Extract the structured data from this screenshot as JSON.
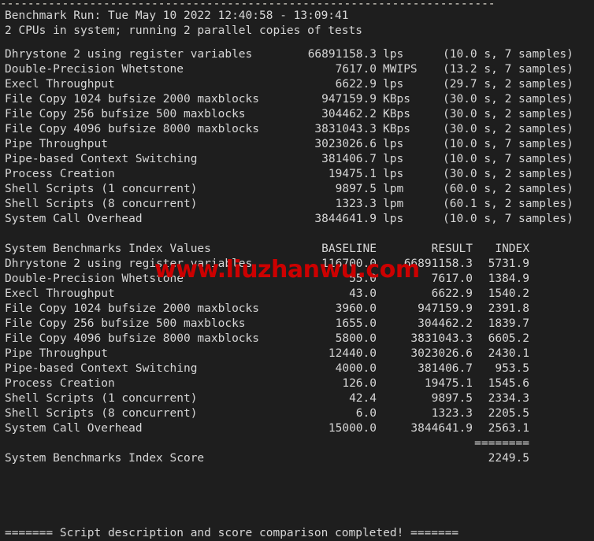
{
  "terminal": {
    "top_rule": "------------------------------------------------------------------------",
    "header_lines": [
      "Benchmark Run: Tue May 10 2022 12:40:58 - 13:09:41",
      "2 CPUs in system; running 2 parallel copies of tests"
    ],
    "results": [
      {
        "name": "Dhrystone 2 using register variables",
        "value": "66891158.3",
        "unit": "lps",
        "timing": "(10.0 s, 7 samples)"
      },
      {
        "name": "Double-Precision Whetstone",
        "value": "7617.0",
        "unit": "MWIPS",
        "timing": "(13.2 s, 7 samples)"
      },
      {
        "name": "Execl Throughput",
        "value": "6622.9",
        "unit": "lps",
        "timing": "(29.7 s, 2 samples)"
      },
      {
        "name": "File Copy 1024 bufsize 2000 maxblocks",
        "value": "947159.9",
        "unit": "KBps",
        "timing": "(30.0 s, 2 samples)"
      },
      {
        "name": "File Copy 256 bufsize 500 maxblocks",
        "value": "304462.2",
        "unit": "KBps",
        "timing": "(30.0 s, 2 samples)"
      },
      {
        "name": "File Copy 4096 bufsize 8000 maxblocks",
        "value": "3831043.3",
        "unit": "KBps",
        "timing": "(30.0 s, 2 samples)"
      },
      {
        "name": "Pipe Throughput",
        "value": "3023026.6",
        "unit": "lps",
        "timing": "(10.0 s, 7 samples)"
      },
      {
        "name": "Pipe-based Context Switching",
        "value": "381406.7",
        "unit": "lps",
        "timing": "(10.0 s, 7 samples)"
      },
      {
        "name": "Process Creation",
        "value": "19475.1",
        "unit": "lps",
        "timing": "(30.0 s, 2 samples)"
      },
      {
        "name": "Shell Scripts (1 concurrent)",
        "value": "9897.5",
        "unit": "lpm",
        "timing": "(60.0 s, 2 samples)"
      },
      {
        "name": "Shell Scripts (8 concurrent)",
        "value": "1323.3",
        "unit": "lpm",
        "timing": "(60.1 s, 2 samples)"
      },
      {
        "name": "System Call Overhead",
        "value": "3844641.9",
        "unit": "lps",
        "timing": "(10.0 s, 7 samples)"
      }
    ],
    "index_table": {
      "title": "System Benchmarks Index Values",
      "col_baseline": "BASELINE",
      "col_result": "RESULT",
      "col_index": "INDEX",
      "rows": [
        {
          "name": "Dhrystone 2 using register variables",
          "baseline": "116700.0",
          "result": "66891158.3",
          "index": "5731.9"
        },
        {
          "name": "Double-Precision Whetstone",
          "baseline": "55.0",
          "result": "7617.0",
          "index": "1384.9"
        },
        {
          "name": "Execl Throughput",
          "baseline": "43.0",
          "result": "6622.9",
          "index": "1540.2"
        },
        {
          "name": "File Copy 1024 bufsize 2000 maxblocks",
          "baseline": "3960.0",
          "result": "947159.9",
          "index": "2391.8"
        },
        {
          "name": "File Copy 256 bufsize 500 maxblocks",
          "baseline": "1655.0",
          "result": "304462.2",
          "index": "1839.7"
        },
        {
          "name": "File Copy 4096 bufsize 8000 maxblocks",
          "baseline": "5800.0",
          "result": "3831043.3",
          "index": "6605.2"
        },
        {
          "name": "Pipe Throughput",
          "baseline": "12440.0",
          "result": "3023026.6",
          "index": "2430.1"
        },
        {
          "name": "Pipe-based Context Switching",
          "baseline": "4000.0",
          "result": "381406.7",
          "index": "953.5"
        },
        {
          "name": "Process Creation",
          "baseline": "126.0",
          "result": "19475.1",
          "index": "1545.6"
        },
        {
          "name": "Shell Scripts (1 concurrent)",
          "baseline": "42.4",
          "result": "9897.5",
          "index": "2334.3"
        },
        {
          "name": "Shell Scripts (8 concurrent)",
          "baseline": "6.0",
          "result": "1323.3",
          "index": "2205.5"
        },
        {
          "name": "System Call Overhead",
          "baseline": "15000.0",
          "result": "3844641.9",
          "index": "2563.1"
        }
      ],
      "separator": "========",
      "score_label": "System Benchmarks Index Score",
      "score_value": "2249.5"
    },
    "footer": "======= Script description and score comparison completed! =======",
    "watermark": "www.liuzhanwu.com",
    "colors": {
      "background": "#1e1e1e",
      "foreground": "#d6d6d6",
      "rule": "#e8e3d8",
      "watermark": "#cc0000"
    }
  }
}
